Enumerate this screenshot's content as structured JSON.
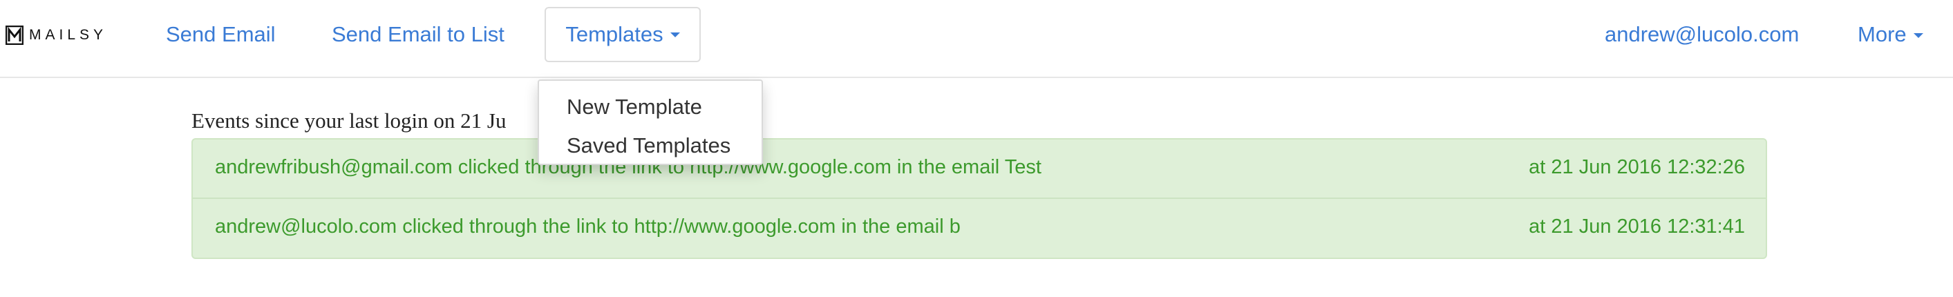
{
  "brand": {
    "name": "MAILSY"
  },
  "nav": {
    "send_email": "Send Email",
    "send_email_to_list": "Send Email to List",
    "templates": "Templates",
    "user_email": "andrew@lucolo.com",
    "more": "More"
  },
  "templates_menu": {
    "items": [
      {
        "label": "New Template"
      },
      {
        "label": "Saved Templates"
      }
    ]
  },
  "events": {
    "heading": "Events since your last login on 21 Ju",
    "rows": [
      {
        "text": "andrewfribush@gmail.com clicked through the link to http://www.google.com in the email Test",
        "time": "at 21 Jun 2016 12:32:26"
      },
      {
        "text": "andrew@lucolo.com clicked through the link to http://www.google.com in the email b",
        "time": "at 21 Jun 2016 12:31:41"
      }
    ]
  },
  "colors": {
    "link": "#3a7bd5",
    "success_bg": "#dff0d8",
    "success_text": "#3c9a2c"
  }
}
